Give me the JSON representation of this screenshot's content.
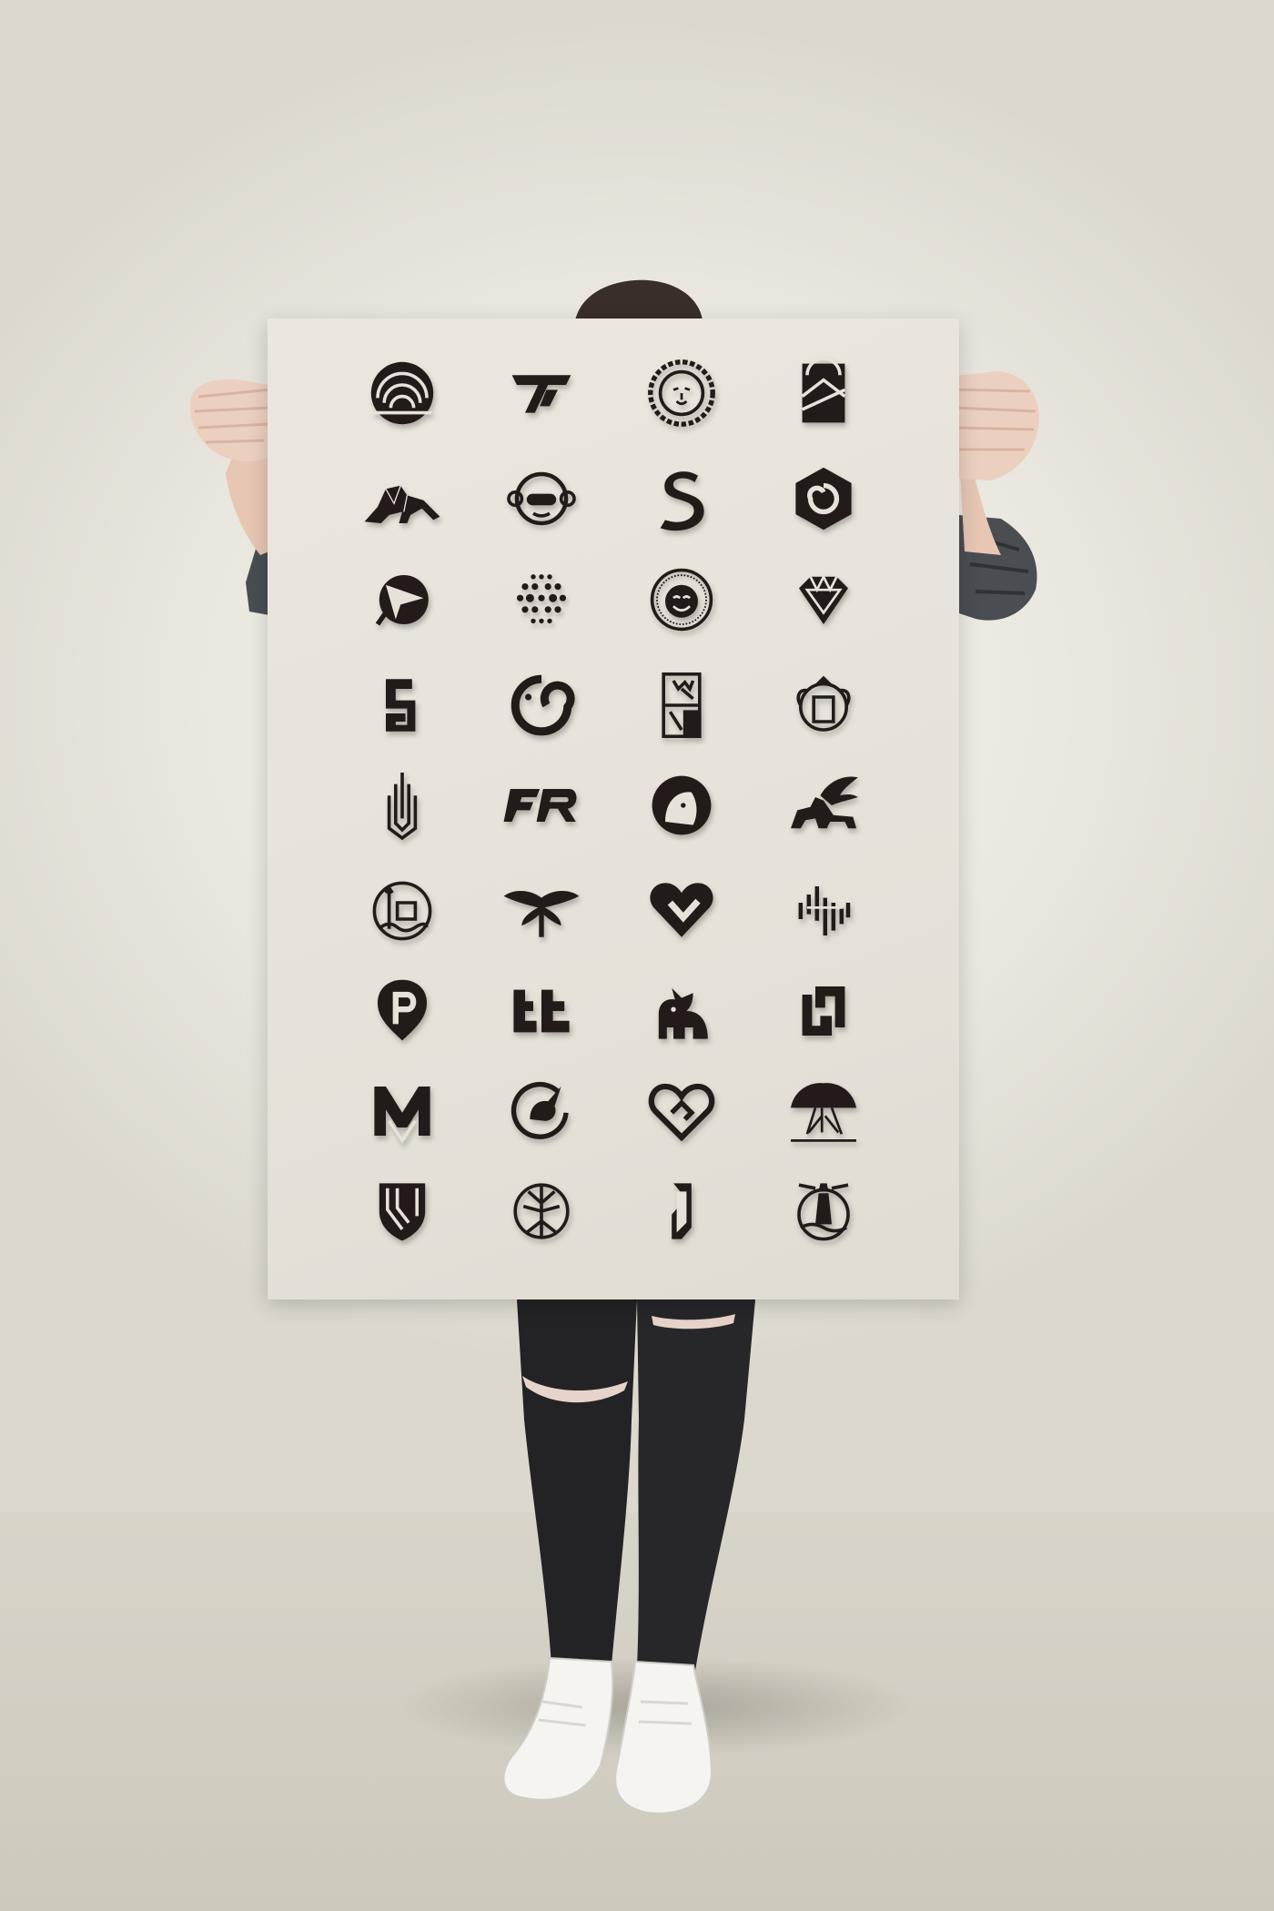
{
  "scene": {
    "subject": "person-holding-poster",
    "colors": {
      "wall": "#ece9e2",
      "floor": "#d5d1c6",
      "poster": "#e6e2d9",
      "ink": "#231a1a",
      "jeans": "#232325",
      "shirt": "#4a4d52",
      "skin": "#e9cbb9",
      "sneaker": "#f5f4f1"
    }
  },
  "poster": {
    "rows": 9,
    "columns": 4,
    "logos": [
      [
        "arches-circle-icon",
        "tt-triangle-monogram-icon",
        "lion-head-circle-icon",
        "mountain-sunrise-square-icon"
      ],
      [
        "geometric-panther-icon",
        "gamer-monkey-icon",
        "swan-s-icon",
        "hexagon-swirl-icon"
      ],
      [
        "paper-plane-circle-icon",
        "dotted-hexagon-m-icon",
        "laughing-buddha-icon",
        "diamond-heart-icon"
      ],
      [
        "bg-monogram-icon",
        "chameleon-icon",
        "king-playing-card-icon",
        "mermaid-crest-icon"
      ],
      [
        "skyscraper-icon",
        "fr-monogram-icon",
        "astronaut-helmet-icon",
        "winged-lion-icon"
      ],
      [
        "neptune-circle-icon",
        "moth-icon",
        "heart-v-icon",
        "soundwave-s-icon"
      ],
      [
        "p-pin-heart-icon",
        "tt-ligature-icon",
        "rhino-icon",
        "interlocked-square-icon"
      ],
      [
        "m-monogram-icon",
        "unicorn-circle-icon",
        "heart-handshake-icon",
        "banyan-tree-icon"
      ],
      [
        "v-shield-icon",
        "tree-roots-circle-icon",
        "a-hexagon-icon",
        "lighthouse-circle-icon"
      ]
    ]
  }
}
